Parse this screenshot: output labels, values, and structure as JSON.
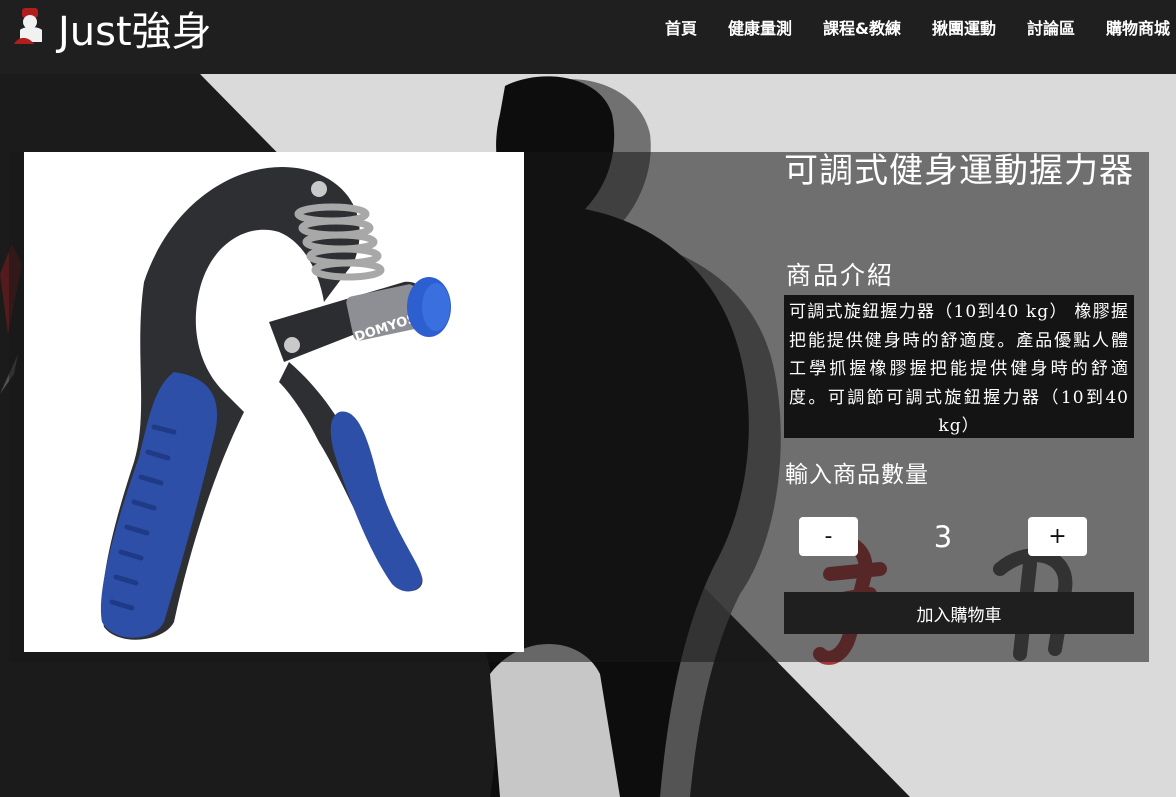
{
  "brand": {
    "name": "Just強身"
  },
  "nav": {
    "items": [
      {
        "label": "首頁"
      },
      {
        "label": "健康量測"
      },
      {
        "label": "課程&教練"
      },
      {
        "label": "揪團運動"
      },
      {
        "label": "討論區"
      },
      {
        "label": "購物商城"
      }
    ]
  },
  "product": {
    "title": "可調式健身運動握力器",
    "intro_heading": "商品介紹",
    "description": "可調式旋鈕握力器（10到40 kg） 橡膠握把能提供健身時的舒適度。產品優點人體工學抓握橡膠握把能提供健身時的舒適度。可調節可調式旋鈕握力器（10到40 kg）",
    "image_brand": "DOMYOS",
    "image_icon": "hand-grip-strengthener-image"
  },
  "quantity": {
    "heading": "輸入商品數量",
    "minus_label": "-",
    "plus_label": "+",
    "value": "3"
  },
  "cart": {
    "add_label": "加入購物車"
  },
  "background": {
    "calligraphy": "強身"
  },
  "colors": {
    "navbar": "#1f1f1f",
    "grip_blue": "#2e4fa8",
    "grip_dark": "#2d2f33",
    "calligraphy_red": "#9a1c1c"
  }
}
